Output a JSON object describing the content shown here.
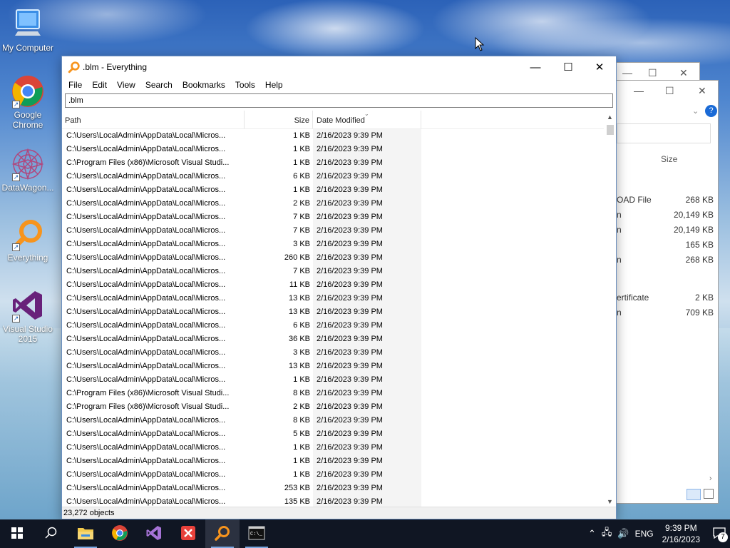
{
  "desktop": {
    "icons": [
      {
        "label": "My Computer",
        "icon": "computer-icon"
      },
      {
        "label": "Google Chrome",
        "icon": "chrome-icon"
      },
      {
        "label": "DataWagon...",
        "icon": "datawagon-icon"
      },
      {
        "label": "Everything",
        "icon": "everything-icon"
      },
      {
        "label": "Visual Studio 2015",
        "icon": "visual-studio-icon"
      }
    ]
  },
  "background_window": {
    "size_header": "Size",
    "rows": [
      {
        "type": "OAD File",
        "size": "268 KB"
      },
      {
        "type": "n",
        "size": "20,149 KB"
      },
      {
        "type": "n",
        "size": "20,149 KB"
      },
      {
        "type": "",
        "size": "165 KB"
      },
      {
        "type": "n",
        "size": "268 KB"
      },
      {
        "type": "ertificate",
        "size": "2 KB"
      },
      {
        "type": "n",
        "size": "709 KB"
      }
    ]
  },
  "window": {
    "title": ".blm - Everything",
    "menu": [
      "File",
      "Edit",
      "View",
      "Search",
      "Bookmarks",
      "Tools",
      "Help"
    ],
    "search_value": ".blm",
    "columns": {
      "path": "Path",
      "size": "Size",
      "date": "Date Modified"
    },
    "rows": [
      {
        "path": "C:\\Users\\LocalAdmin\\AppData\\Local\\Micros...",
        "size": "1 KB",
        "date": "2/16/2023 9:39 PM"
      },
      {
        "path": "C:\\Users\\LocalAdmin\\AppData\\Local\\Micros...",
        "size": "1 KB",
        "date": "2/16/2023 9:39 PM"
      },
      {
        "path": "C:\\Program Files (x86)\\Microsoft Visual Studi...",
        "size": "1 KB",
        "date": "2/16/2023 9:39 PM"
      },
      {
        "path": "C:\\Users\\LocalAdmin\\AppData\\Local\\Micros...",
        "size": "6 KB",
        "date": "2/16/2023 9:39 PM"
      },
      {
        "path": "C:\\Users\\LocalAdmin\\AppData\\Local\\Micros...",
        "size": "1 KB",
        "date": "2/16/2023 9:39 PM"
      },
      {
        "path": "C:\\Users\\LocalAdmin\\AppData\\Local\\Micros...",
        "size": "2 KB",
        "date": "2/16/2023 9:39 PM"
      },
      {
        "path": "C:\\Users\\LocalAdmin\\AppData\\Local\\Micros...",
        "size": "7 KB",
        "date": "2/16/2023 9:39 PM"
      },
      {
        "path": "C:\\Users\\LocalAdmin\\AppData\\Local\\Micros...",
        "size": "7 KB",
        "date": "2/16/2023 9:39 PM"
      },
      {
        "path": "C:\\Users\\LocalAdmin\\AppData\\Local\\Micros...",
        "size": "3 KB",
        "date": "2/16/2023 9:39 PM"
      },
      {
        "path": "C:\\Users\\LocalAdmin\\AppData\\Local\\Micros...",
        "size": "260 KB",
        "date": "2/16/2023 9:39 PM"
      },
      {
        "path": "C:\\Users\\LocalAdmin\\AppData\\Local\\Micros...",
        "size": "7 KB",
        "date": "2/16/2023 9:39 PM"
      },
      {
        "path": "C:\\Users\\LocalAdmin\\AppData\\Local\\Micros...",
        "size": "11 KB",
        "date": "2/16/2023 9:39 PM"
      },
      {
        "path": "C:\\Users\\LocalAdmin\\AppData\\Local\\Micros...",
        "size": "13 KB",
        "date": "2/16/2023 9:39 PM"
      },
      {
        "path": "C:\\Users\\LocalAdmin\\AppData\\Local\\Micros...",
        "size": "13 KB",
        "date": "2/16/2023 9:39 PM"
      },
      {
        "path": "C:\\Users\\LocalAdmin\\AppData\\Local\\Micros...",
        "size": "6 KB",
        "date": "2/16/2023 9:39 PM"
      },
      {
        "path": "C:\\Users\\LocalAdmin\\AppData\\Local\\Micros...",
        "size": "36 KB",
        "date": "2/16/2023 9:39 PM"
      },
      {
        "path": "C:\\Users\\LocalAdmin\\AppData\\Local\\Micros...",
        "size": "3 KB",
        "date": "2/16/2023 9:39 PM"
      },
      {
        "path": "C:\\Users\\LocalAdmin\\AppData\\Local\\Micros...",
        "size": "13 KB",
        "date": "2/16/2023 9:39 PM"
      },
      {
        "path": "C:\\Users\\LocalAdmin\\AppData\\Local\\Micros...",
        "size": "1 KB",
        "date": "2/16/2023 9:39 PM"
      },
      {
        "path": "C:\\Program Files (x86)\\Microsoft Visual Studi...",
        "size": "8 KB",
        "date": "2/16/2023 9:39 PM"
      },
      {
        "path": "C:\\Program Files (x86)\\Microsoft Visual Studi...",
        "size": "2 KB",
        "date": "2/16/2023 9:39 PM"
      },
      {
        "path": "C:\\Users\\LocalAdmin\\AppData\\Local\\Micros...",
        "size": "8 KB",
        "date": "2/16/2023 9:39 PM"
      },
      {
        "path": "C:\\Users\\LocalAdmin\\AppData\\Local\\Micros...",
        "size": "5 KB",
        "date": "2/16/2023 9:39 PM"
      },
      {
        "path": "C:\\Users\\LocalAdmin\\AppData\\Local\\Micros...",
        "size": "1 KB",
        "date": "2/16/2023 9:39 PM"
      },
      {
        "path": "C:\\Users\\LocalAdmin\\AppData\\Local\\Micros...",
        "size": "1 KB",
        "date": "2/16/2023 9:39 PM"
      },
      {
        "path": "C:\\Users\\LocalAdmin\\AppData\\Local\\Micros...",
        "size": "1 KB",
        "date": "2/16/2023 9:39 PM"
      },
      {
        "path": "C:\\Users\\LocalAdmin\\AppData\\Local\\Micros...",
        "size": "253 KB",
        "date": "2/16/2023 9:39 PM"
      },
      {
        "path": "C:\\Users\\LocalAdmin\\AppData\\Local\\Micros...",
        "size": "135 KB",
        "date": "2/16/2023 9:39 PM"
      }
    ],
    "status": "23,272 objects"
  },
  "taskbar": {
    "items": [
      "start-icon",
      "search-icon",
      "file-explorer-icon",
      "chrome-icon",
      "visual-studio-icon",
      "close-app-icon",
      "everything-icon",
      "command-prompt-icon"
    ],
    "language": "ENG",
    "time": "9:39 PM",
    "date": "2/16/2023",
    "notification_count": "7"
  },
  "colors": {
    "accent": "#0078d7",
    "everything_orange": "#f7941d",
    "vs_purple": "#68217a"
  }
}
